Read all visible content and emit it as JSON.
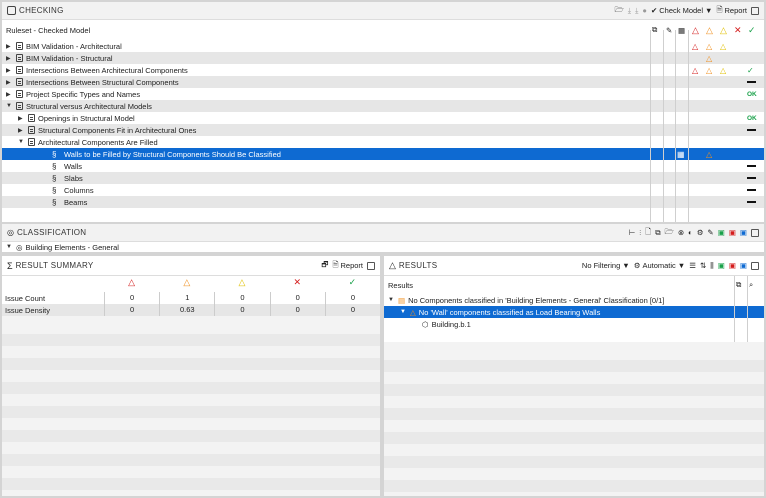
{
  "checking": {
    "title": "CHECKING",
    "check_model_label": "Check Model",
    "report_label": "Report",
    "column_header": "Ruleset - Checked Model",
    "rows": [
      {
        "label": "BIM Validation - Architectural",
        "indent": 0,
        "expand": "▶",
        "kind": "ruleset",
        "issues": "ryo"
      },
      {
        "label": "BIM Validation - Structural",
        "indent": 0,
        "expand": "▶",
        "kind": "ruleset",
        "issues": "o"
      },
      {
        "label": "Intersections Between Architectural Components",
        "indent": 0,
        "expand": "▶",
        "kind": "ruleset",
        "issues": "roy",
        "status": "check"
      },
      {
        "label": "Intersections Between Structural Components",
        "indent": 0,
        "expand": "▶",
        "kind": "ruleset",
        "issues": "",
        "status": "dash"
      },
      {
        "label": "Project Specific Types and Names",
        "indent": 0,
        "expand": "▶",
        "kind": "ruleset",
        "issues": "",
        "status": "ok"
      },
      {
        "label": "Structural versus Architectural Models",
        "indent": 0,
        "expand": "▼",
        "kind": "ruleset",
        "issues": ""
      },
      {
        "label": "Openings in Structural Model",
        "indent": 1,
        "expand": "▶",
        "kind": "ruleset",
        "issues": "",
        "status": "ok"
      },
      {
        "label": "Structural Components Fit in Architectural Ones",
        "indent": 1,
        "expand": "▶",
        "kind": "ruleset",
        "issues": "",
        "status": "dash"
      },
      {
        "label": "Architectural Components Are Filled",
        "indent": 1,
        "expand": "▼",
        "kind": "ruleset",
        "issues": ""
      },
      {
        "label": "Walls to be Filled by Structural Components Should Be Classified",
        "indent": 2,
        "expand": "",
        "kind": "rule",
        "issues": "o",
        "selected": true,
        "grid": true
      },
      {
        "label": "Walls",
        "indent": 2,
        "expand": "",
        "kind": "rule",
        "issues": "",
        "status": "dash"
      },
      {
        "label": "Slabs",
        "indent": 2,
        "expand": "",
        "kind": "rule",
        "issues": "",
        "status": "dash"
      },
      {
        "label": "Columns",
        "indent": 2,
        "expand": "",
        "kind": "rule",
        "issues": "",
        "status": "dash"
      },
      {
        "label": "Beams",
        "indent": 2,
        "expand": "",
        "kind": "rule",
        "issues": "",
        "status": "dash"
      }
    ],
    "ok_text": "OK"
  },
  "classification": {
    "title": "CLASSIFICATION",
    "item": "Building Elements - General"
  },
  "result_summary": {
    "title": "RESULT SUMMARY",
    "report_label": "Report",
    "rows": [
      {
        "label": "Issue Count",
        "values": [
          "0",
          "1",
          "0",
          "0",
          "0"
        ]
      },
      {
        "label": "Issue Density",
        "values": [
          "0",
          "0.63",
          "0",
          "0",
          "0"
        ]
      }
    ]
  },
  "results": {
    "title": "RESULTS",
    "filter_label": "No Filtering",
    "auto_label": "Automatic",
    "column_header": "Results",
    "items": [
      {
        "label": "No Components classified in 'Building Elements - General' Classification [0/1]",
        "indent": 0
      },
      {
        "label": "No 'Wall' components classified as Load Bearing Walls",
        "indent": 1,
        "selected": true
      },
      {
        "label": "Building.b.1",
        "indent": 2
      }
    ]
  },
  "colors": {
    "selection": "#0e6ad2",
    "critical": "#d41c1c",
    "moderate": "#f09020",
    "low": "#e0c000",
    "ok": "#1aa14a"
  }
}
